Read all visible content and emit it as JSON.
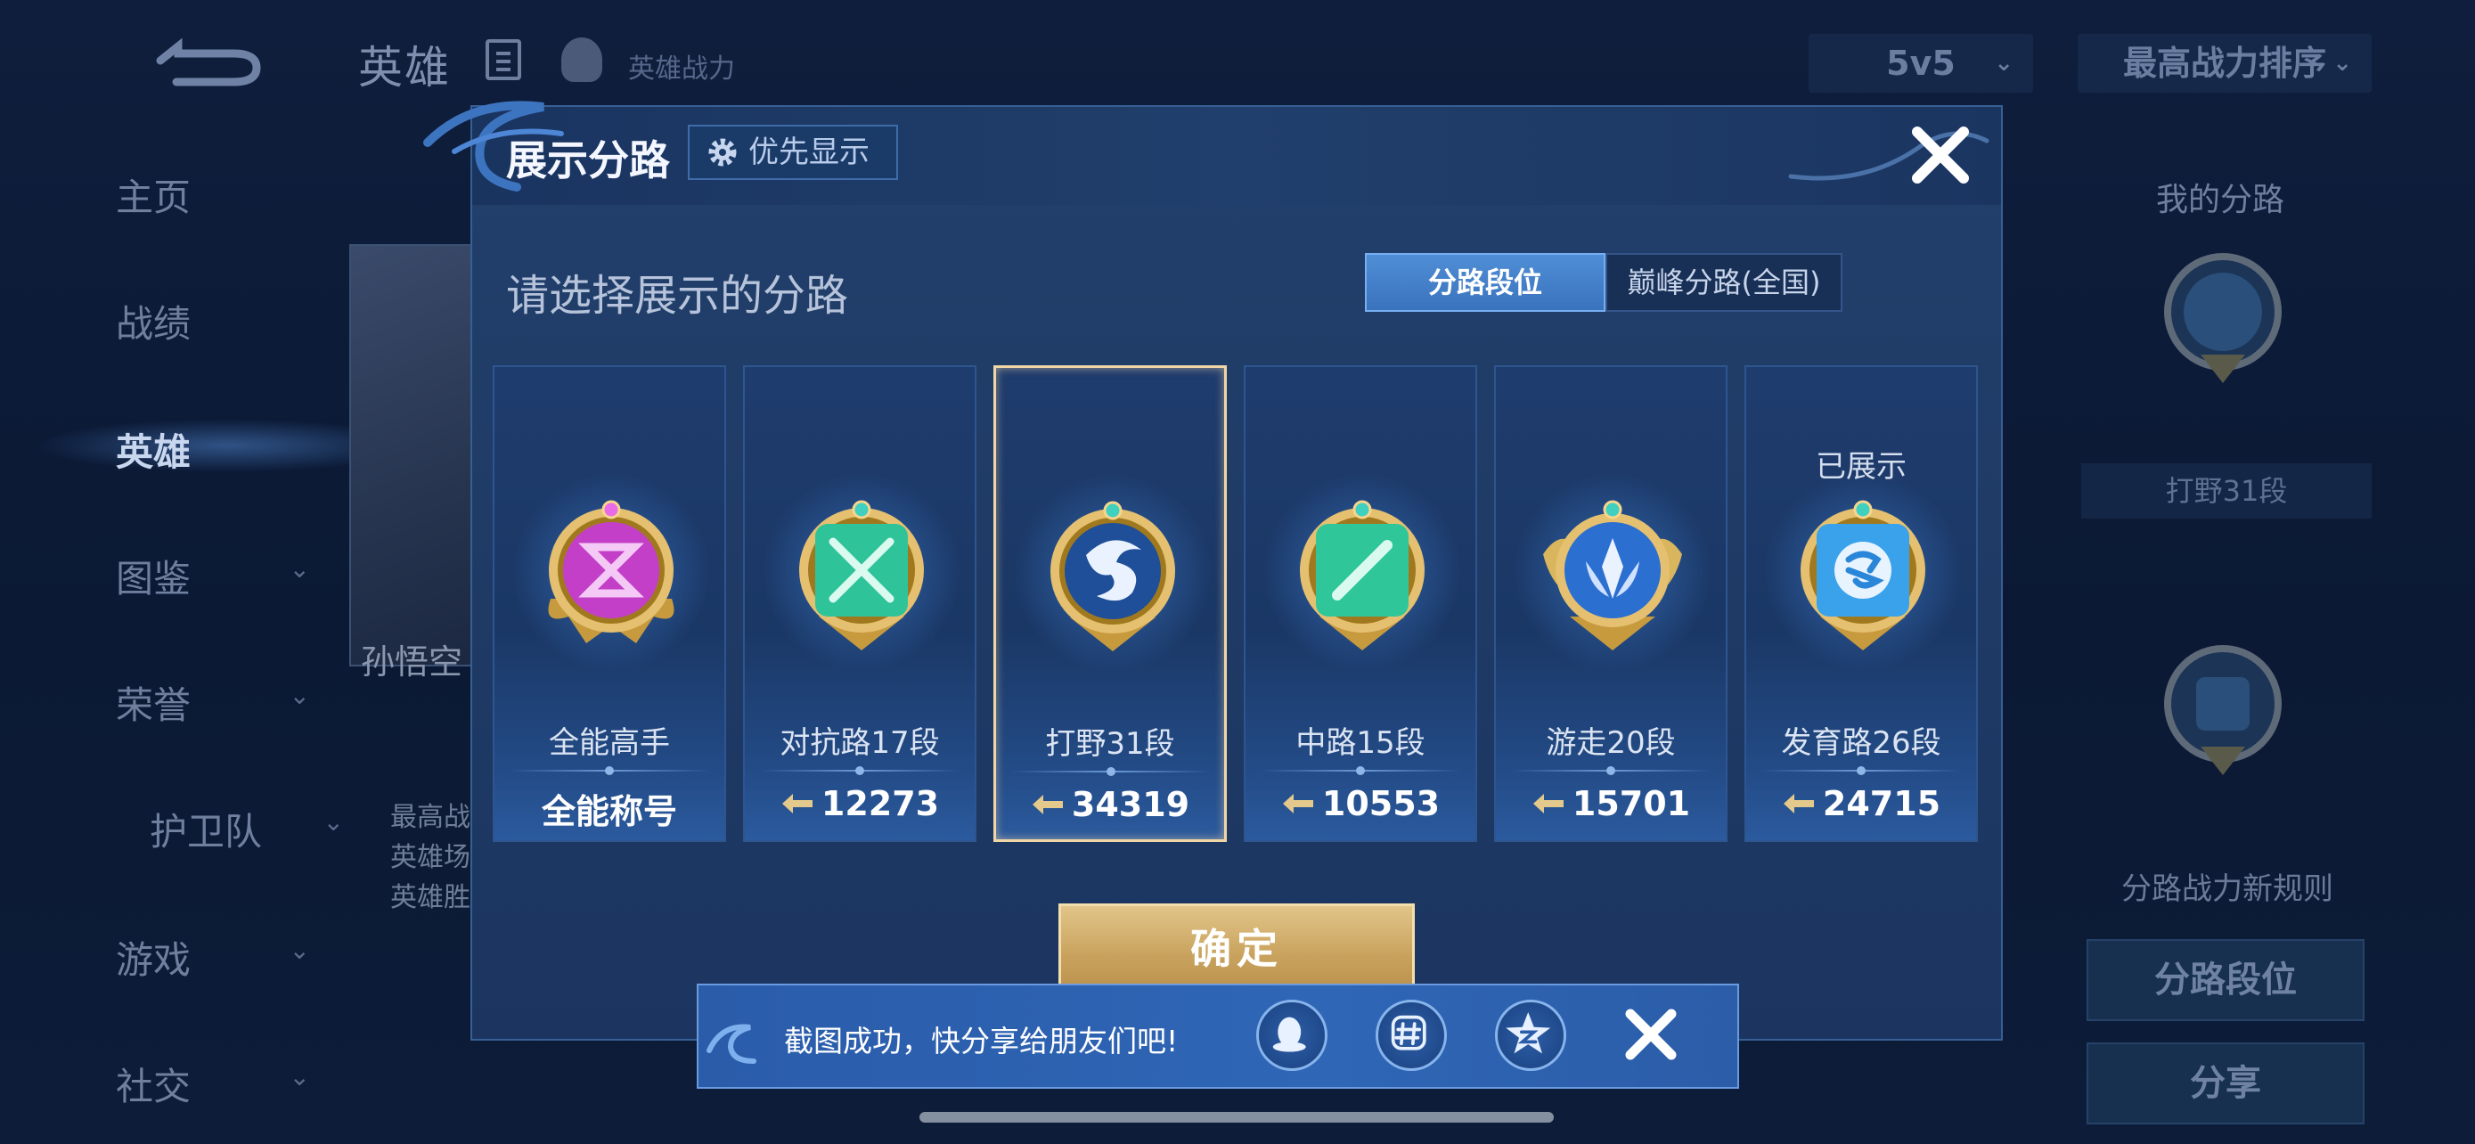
{
  "header": {
    "title": "英雄",
    "sub_label": "英雄战力",
    "mode_select": "5v5",
    "sort_select": "最高战力排序"
  },
  "sidebar": {
    "items": [
      {
        "label": "主页"
      },
      {
        "label": "战绩"
      },
      {
        "label": "英雄"
      },
      {
        "label": "图鉴"
      },
      {
        "label": "荣誉"
      },
      {
        "label": "护卫队"
      },
      {
        "label": "游戏"
      },
      {
        "label": "社交"
      }
    ],
    "active": "英雄"
  },
  "hero_card": {
    "name": "孙悟空",
    "info_lines": [
      "最高战",
      "英雄场",
      "英雄胜"
    ]
  },
  "right_panel": {
    "title": "我的分路",
    "current_lane": "打野31段",
    "rule_link": "分路战力新规则",
    "lane_rank_button": "分路段位",
    "share_button": "分享"
  },
  "dialog": {
    "title": "展示分路",
    "priority_button": "优先显示",
    "subtitle": "请选择展示的分路",
    "tabs": [
      "分路段位",
      "巅峰分路(全国)"
    ],
    "active_tab": "分路段位",
    "confirm_button": "确定",
    "cards": [
      {
        "name": "全能高手",
        "value": "全能称号",
        "selected": false,
        "shown_label": "",
        "color": "#c23fc6"
      },
      {
        "name": "对抗路17段",
        "value": "12273",
        "selected": false,
        "shown_label": "",
        "color": "#31c9a0"
      },
      {
        "name": "打野31段",
        "value": "34319",
        "selected": true,
        "shown_label": "",
        "color": "#2f6fd0"
      },
      {
        "name": "中路15段",
        "value": "10553",
        "selected": false,
        "shown_label": "",
        "color": "#2fc79a"
      },
      {
        "name": "游走20段",
        "value": "15701",
        "selected": false,
        "shown_label": "",
        "color": "#3b7fe0"
      },
      {
        "name": "发育路26段",
        "value": "24715",
        "selected": false,
        "shown_label": "已展示",
        "color": "#3aa0ea"
      }
    ]
  },
  "toast": {
    "text": "截图成功，快分享给朋友们吧!",
    "share_icons": [
      "qq-icon",
      "moments-icon",
      "qzone-icon"
    ]
  },
  "colors": {
    "accent_gold": "#d8b978",
    "selected_border": "#f0d6a6",
    "tab_active": "#4a86cf"
  }
}
